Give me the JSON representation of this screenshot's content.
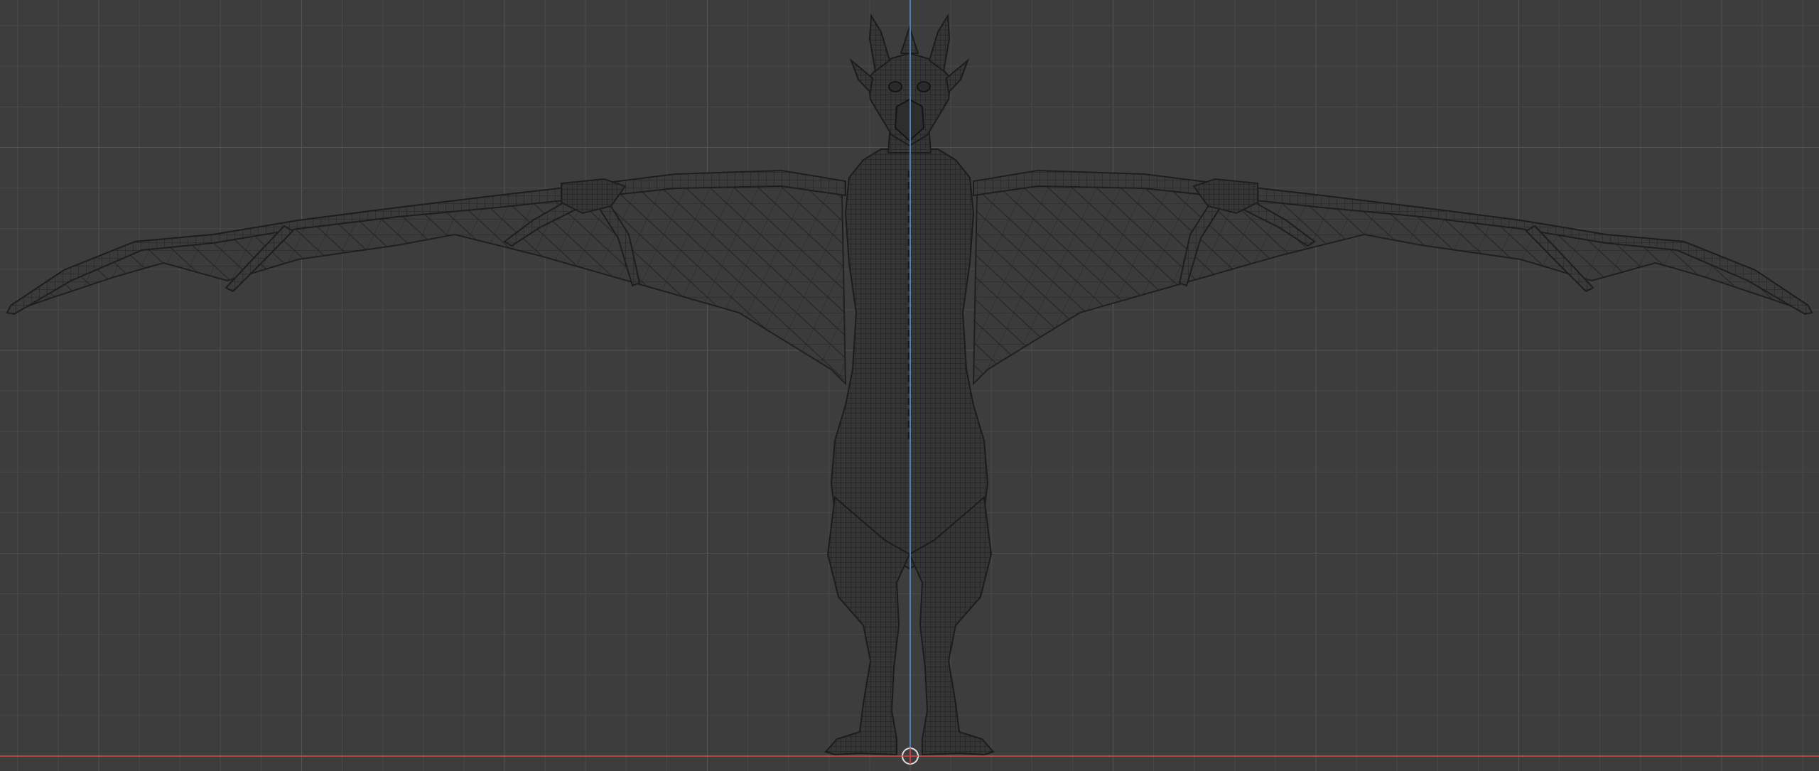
{
  "app": {
    "view": "3d-viewport",
    "shading": "wireframe",
    "projection": "orthographic-front"
  },
  "colors": {
    "background": "#3d3d3d",
    "grid_minor": "#4a4a4a",
    "grid_major": "#555555",
    "axis_z": "#4a7fc0",
    "axis_x": "#b04848",
    "wire": "#1f1f1f",
    "mesh_fill": "#3a3a3a",
    "origin_ring": "#e0e0e0",
    "origin_inner": "#c04040"
  },
  "icons": {
    "origin": "object-origin-icon"
  }
}
